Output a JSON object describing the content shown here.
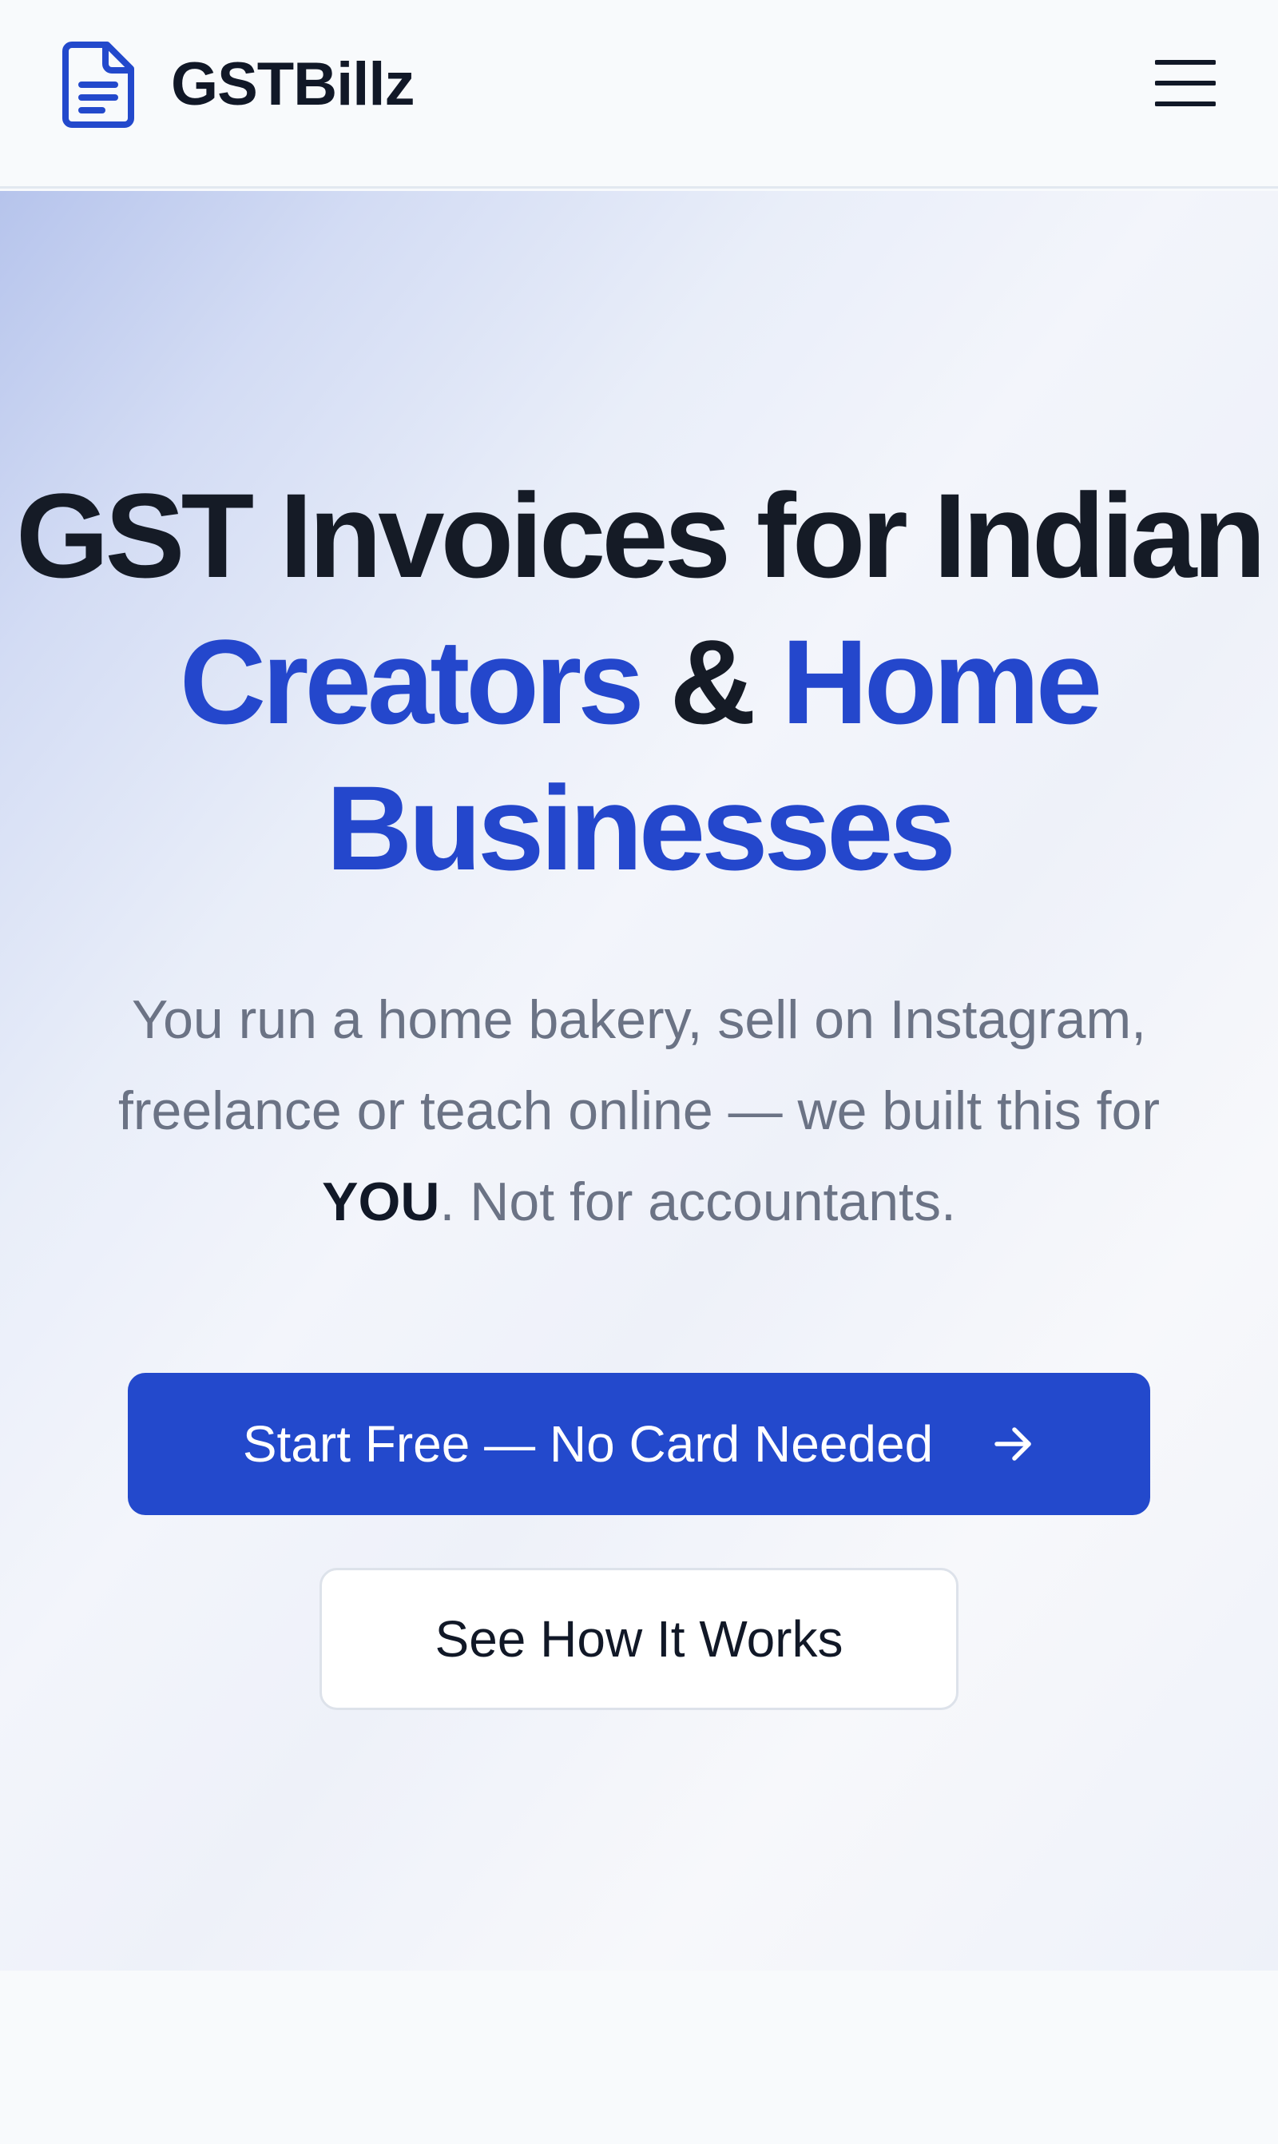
{
  "header": {
    "brand_name": "GSTBillz",
    "logo_icon": "document-icon",
    "menu_icon": "hamburger-menu-icon"
  },
  "hero": {
    "title_line1": "GST Invoices for Indian",
    "title_accent1": "Creators",
    "title_amp": "&",
    "title_accent2": "Home",
    "title_accent3": "Businesses",
    "subtitle_line1": "You run a home bakery, sell on Instagram,",
    "subtitle_line2": "freelance or teach online — we built this for",
    "subtitle_emphasis": "YOU",
    "subtitle_tail": ". Not for accountants.",
    "primary_cta_label": "Start Free — No Card Needed",
    "primary_cta_icon": "arrow-right-icon",
    "secondary_cta_label": "See How It Works"
  },
  "colors": {
    "brand_blue": "#2349cc",
    "heading": "#151b26",
    "muted_text": "#6b7385",
    "page_bg": "#f8fafc"
  }
}
